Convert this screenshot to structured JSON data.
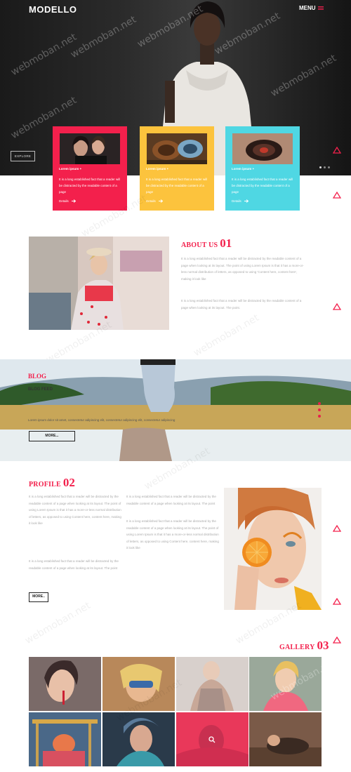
{
  "header": {
    "logo": "MODELLO",
    "menu_label": "MENU",
    "explore_label": "EXPLORE"
  },
  "cards": [
    {
      "title": "Lorem ipsum +",
      "text": "It is a long established fact that a reader will be distracted by the readable content of a page",
      "more": "Details"
    },
    {
      "title": "Lorem ipsum +",
      "text": "It is a long established fact that a reader will be distracted by the readable content of a page",
      "more": "Details"
    },
    {
      "title": "Lorem ipsum +",
      "text": "It is a long established fact that a reader will be distracted by the readable content of a page",
      "more": "Details"
    }
  ],
  "about": {
    "title": "ABOUT US",
    "number": "01",
    "para1": "It is a long established fact that a reader will be distracted by the readable content of a page when looking at its layout. The point of using Lorem Ipsum is that it has a more-or-less normal distribution of letters, as opposed to using 'Content here, content here', making it look like",
    "para2": "It is a long established fact that a reader will be distracted by the readable content of a page when looking at its layout. The point."
  },
  "blog": {
    "title": "BLOG",
    "feed": "BLOG FEED",
    "line": "Lorem ipsum dolor sit amet, consectetur adipiscing elit, consectetur adipiscing elit, consectetur adipiscing",
    "more": "MORE..."
  },
  "profile": {
    "title": "PROFILE",
    "number": "02",
    "col1_para1": "It is a long established fact that a reader will be distracted by the readable content of a page when looking at its layout. The point of using Lorem Ipsum is that it has a more-or-less normal distribution of letters, as opposed to using Content here, content here, making it look like",
    "col1_para2": "It is a long established fact that a reader will be distracted by the readable content of a page when looking at its layout. The point",
    "col2_para1": "It is a long established fact that a reader will be distracted by the readable content of a page when looking at its layout. The point",
    "col2_para2": "It is a long established fact that a reader will be distracted by the readable content of a page when looking at its layout. The point of using Lorem Ipsum is that it has a more-or-less normal distribution of letters, as opposed to using Content here, content here, making it look like",
    "more": "MORE.."
  },
  "gallery": {
    "title": "GALLERY",
    "number": "03"
  },
  "watermark": "webmoban.net",
  "colors": {
    "accent_red": "#f3204c",
    "accent_yellow": "#fcc33d",
    "accent_cyan": "#4fd7e3"
  }
}
